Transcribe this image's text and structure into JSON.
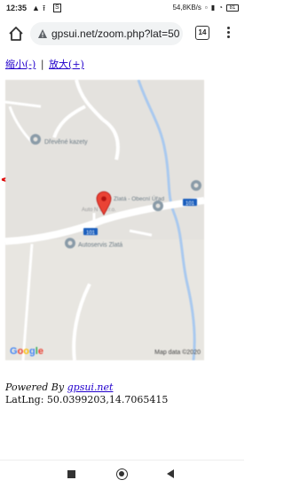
{
  "status": {
    "time": "12:35",
    "net_speed": "54,8KB/s",
    "battery": "81"
  },
  "browser": {
    "url": "gpsui.net/zoom.php?lat=50.0",
    "tab_count": "14"
  },
  "zoom": {
    "zoom_out": "缩小(-)",
    "separator": "|",
    "zoom_in": "放大(+)"
  },
  "map": {
    "labels": {
      "poi1": "Dřevěné kazety",
      "poi2": "Zlatá - Obecní Úřad",
      "poi3": "Autoservis Zlatá",
      "marker_label": "Auto N S s.r.o.",
      "road1": "101",
      "road2": "101"
    },
    "google": "Google",
    "attribution": "Map data ©2020",
    "back_arrow": "<"
  },
  "footer": {
    "powered_prefix": "Powered By ",
    "powered_link": "gpsui.net",
    "latlng": "LatLng: 50.0399203,14.7065415"
  },
  "colors": {
    "link": "#2200cc",
    "arrow": "#e00000",
    "marker": "#ea4335"
  }
}
